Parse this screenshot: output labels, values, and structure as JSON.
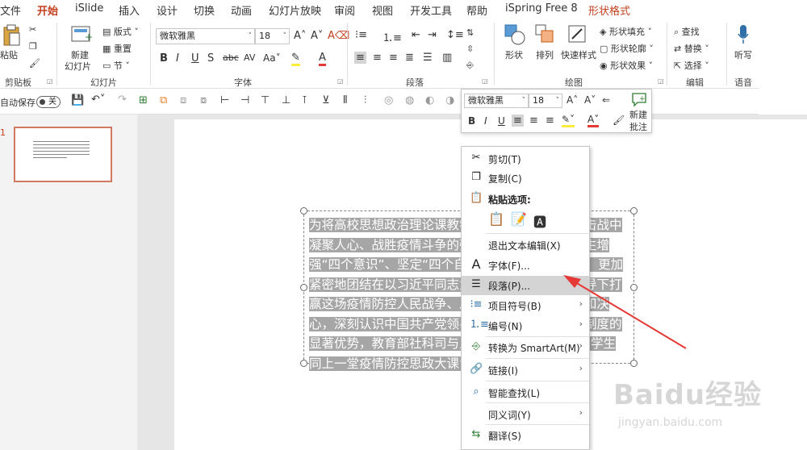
{
  "tabs": [
    "文件",
    "开始",
    "iSlide",
    "插入",
    "设计",
    "切换",
    "动画",
    "幻灯片放映",
    "审阅",
    "视图",
    "开发工具",
    "帮助",
    "iSpring Free 8",
    "形状格式"
  ],
  "ribbon": {
    "clipboard": {
      "paste": "粘贴",
      "label": "剪贴板"
    },
    "slides": {
      "new_slide": "新建",
      "new_slide2": "幻灯片",
      "layout": "版式",
      "reset": "重置",
      "section": "节",
      "label": "幻灯片"
    },
    "font": {
      "name": "微软雅黑",
      "size": "18",
      "label": "字体"
    },
    "paragraph": {
      "label": "段落"
    },
    "drawing": {
      "shapes": "形状",
      "arrange": "排列",
      "quick_styles": "快速样式",
      "fill": "形状填充",
      "outline": "形状轮廓",
      "effects": "形状效果",
      "label": "绘图"
    },
    "editing": {
      "find": "查找",
      "replace": "替换",
      "select": "选择",
      "label": "编辑"
    },
    "voice": {
      "dictate": "听写",
      "label": "语音"
    }
  },
  "qat": {
    "autosave": "自动保存",
    "toggle": "关"
  },
  "slide_panel": {
    "number": "1"
  },
  "slide_text": "为将高校思想政治理论课教学打造成为疫情防控阻击战中凝聚人心、战胜疫情斗争的强大力量，引导广大学生增强“四个意识”、坚定“四个自信”、做到“两个维护”，更加紧密地团结在以习近平同志为核心的党中央坚强领导下打赢这场疫情防控人民战争、总体战、阻击战的信心和决心，深刻认识中国共产党领导和中国特色社会主义制度的显著优势，教育部社科司与人民网联合组织“全国大学生同上一堂疫情防控思政大课”。",
  "mini_toolbar": {
    "font": "微软雅黑",
    "size": "18",
    "new_comment1": "新建",
    "new_comment2": "批注"
  },
  "context_menu": {
    "items": [
      {
        "label": "剪切(T)",
        "icon": "cut-icon"
      },
      {
        "label": "复制(C)",
        "icon": "copy-icon"
      },
      {
        "label": "粘贴选项:",
        "icon": "paste-icon"
      },
      {
        "label": "退出文本编辑(X)",
        "icon": ""
      },
      {
        "label": "字体(F)...",
        "icon": "font-icon"
      },
      {
        "label": "段落(P)...",
        "icon": "paragraph-icon"
      },
      {
        "label": "项目符号(B)",
        "icon": "bullets-icon"
      },
      {
        "label": "编号(N)",
        "icon": "numbering-icon"
      },
      {
        "label": "转换为 SmartArt(M)",
        "icon": "smartart-icon"
      },
      {
        "label": "链接(I)",
        "icon": "link-icon"
      },
      {
        "label": "智能查找(L)",
        "icon": "smart-lookup-icon"
      },
      {
        "label": "同义词(Y)",
        "icon": ""
      },
      {
        "label": "翻译(S)",
        "icon": "translate-icon"
      }
    ]
  },
  "watermark": {
    "brand": "Baidu经验",
    "url": "jingyan.baidu.com"
  },
  "colors": {
    "accent": "#c43e1c",
    "highlight": "#a6a6a6",
    "arrow": "#e53935"
  }
}
